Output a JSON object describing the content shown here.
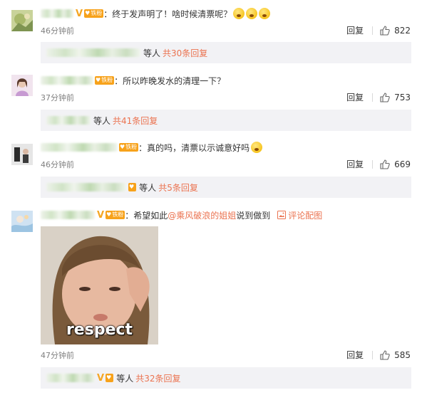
{
  "colors": {
    "accent": "#eb7350",
    "badge": "#f7a21b",
    "vip": "#f5a623",
    "muted": "#808080",
    "sub_bg": "#f2f2f5"
  },
  "labels": {
    "reply": "回复",
    "people_suffix": "等人"
  },
  "comments": [
    {
      "text": "：终于发声明了！啥时候清票呢？",
      "time": "46分钟前",
      "likes": "822",
      "badge": "铁粉",
      "reply_more": "共30条回复"
    },
    {
      "text": "：所以昨晚发水的清理一下？",
      "time": "37分钟前",
      "likes": "753",
      "badge": "铁粉",
      "reply_more": "共41条回复"
    },
    {
      "text": "：真的吗，清票以示诚意好吗",
      "time": "46分钟前",
      "likes": "669",
      "badge": "铁粉",
      "reply_more": "共5条回复"
    },
    {
      "text_prefix": "：希望如此",
      "mention": "@乘风破浪的姐姐",
      "text_suffix": " 说到做到",
      "pic_comment": "评论配图",
      "image_caption": "respect",
      "time": "47分钟前",
      "likes": "585",
      "badge": "铁粉",
      "reply_more": "共32条回复"
    }
  ]
}
